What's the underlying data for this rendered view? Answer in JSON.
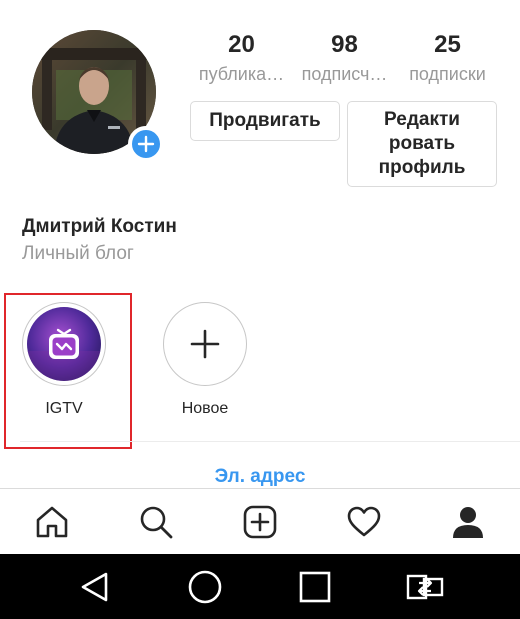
{
  "profile": {
    "stats": [
      {
        "value": "20",
        "label": "публика…"
      },
      {
        "value": "98",
        "label": "подписч…"
      },
      {
        "value": "25",
        "label": "подписки"
      }
    ],
    "promote_label": "Продвигать",
    "edit_label": "Редакти ровать профиль",
    "name": "Дмитрий Костин",
    "category": "Личный блог"
  },
  "highlights": [
    {
      "label": "IGTV",
      "icon": "igtv-icon"
    },
    {
      "label": "Новое",
      "icon": "plus-icon"
    }
  ],
  "contact": {
    "email_label": "Эл. адрес"
  },
  "tabbar": [
    "home-icon",
    "search-icon",
    "new-post-icon",
    "heart-icon",
    "profile-icon"
  ],
  "system_nav": [
    "back-icon",
    "home-circle-icon",
    "recents-icon",
    "screen-rotate-icon"
  ],
  "colors": {
    "accent": "#3897f0",
    "highlight_frame": "#e0262b",
    "muted_text": "#999999"
  }
}
